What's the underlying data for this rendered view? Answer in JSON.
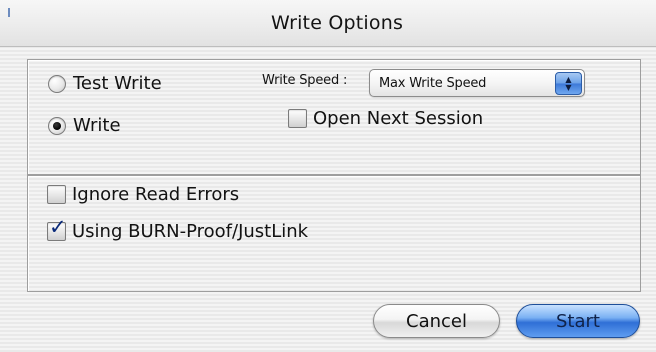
{
  "window": {
    "title": "Write Options"
  },
  "write_mode": {
    "options": [
      {
        "label": "Test Write",
        "selected": false
      },
      {
        "label": "Write",
        "selected": true
      }
    ]
  },
  "write_speed": {
    "label": "Write Speed :",
    "selected_value": "Max Write Speed"
  },
  "checkboxes": {
    "open_next_session": {
      "label": "Open Next Session",
      "checked": false
    },
    "ignore_read_errors": {
      "label": "Ignore Read Errors",
      "checked": false
    },
    "burn_proof": {
      "label": "Using BURN-Proof/JustLink",
      "checked": true
    }
  },
  "buttons": {
    "cancel": "Cancel",
    "start": "Start"
  },
  "colors": {
    "default_button": "#2f6fd6",
    "checkmark": "#0a2a7a"
  }
}
